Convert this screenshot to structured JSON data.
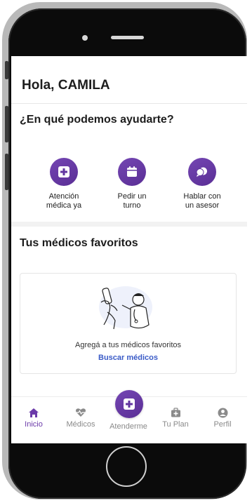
{
  "greeting": "Hola, CAMILA",
  "help_title": "¿En qué podemos ayudarte?",
  "actions": [
    {
      "label": "Atención\nmédica ya",
      "icon": "medical-cross-icon"
    },
    {
      "label": "Pedir un\nturno",
      "icon": "calendar-icon"
    },
    {
      "label": "Hablar con\nun asesor",
      "icon": "chat-bubbles-icon"
    }
  ],
  "favorites": {
    "title": "Tus médicos favoritos",
    "empty_text": "Agregá a tus médicos favoritos",
    "link": "Buscar médicos"
  },
  "tabs": [
    {
      "label": "Inicio",
      "icon": "home-icon",
      "active": true
    },
    {
      "label": "Médicos",
      "icon": "heart-pulse-icon"
    },
    {
      "label": "Atenderme",
      "icon": "medical-cross-icon"
    },
    {
      "label": "Tu Plan",
      "icon": "briefcase-icon"
    },
    {
      "label": "Perfil",
      "icon": "user-icon"
    }
  ],
  "colors": {
    "accent": "#6b3aa9",
    "link": "#3a5bc7",
    "inactive_tab": "#8a8a8a"
  }
}
